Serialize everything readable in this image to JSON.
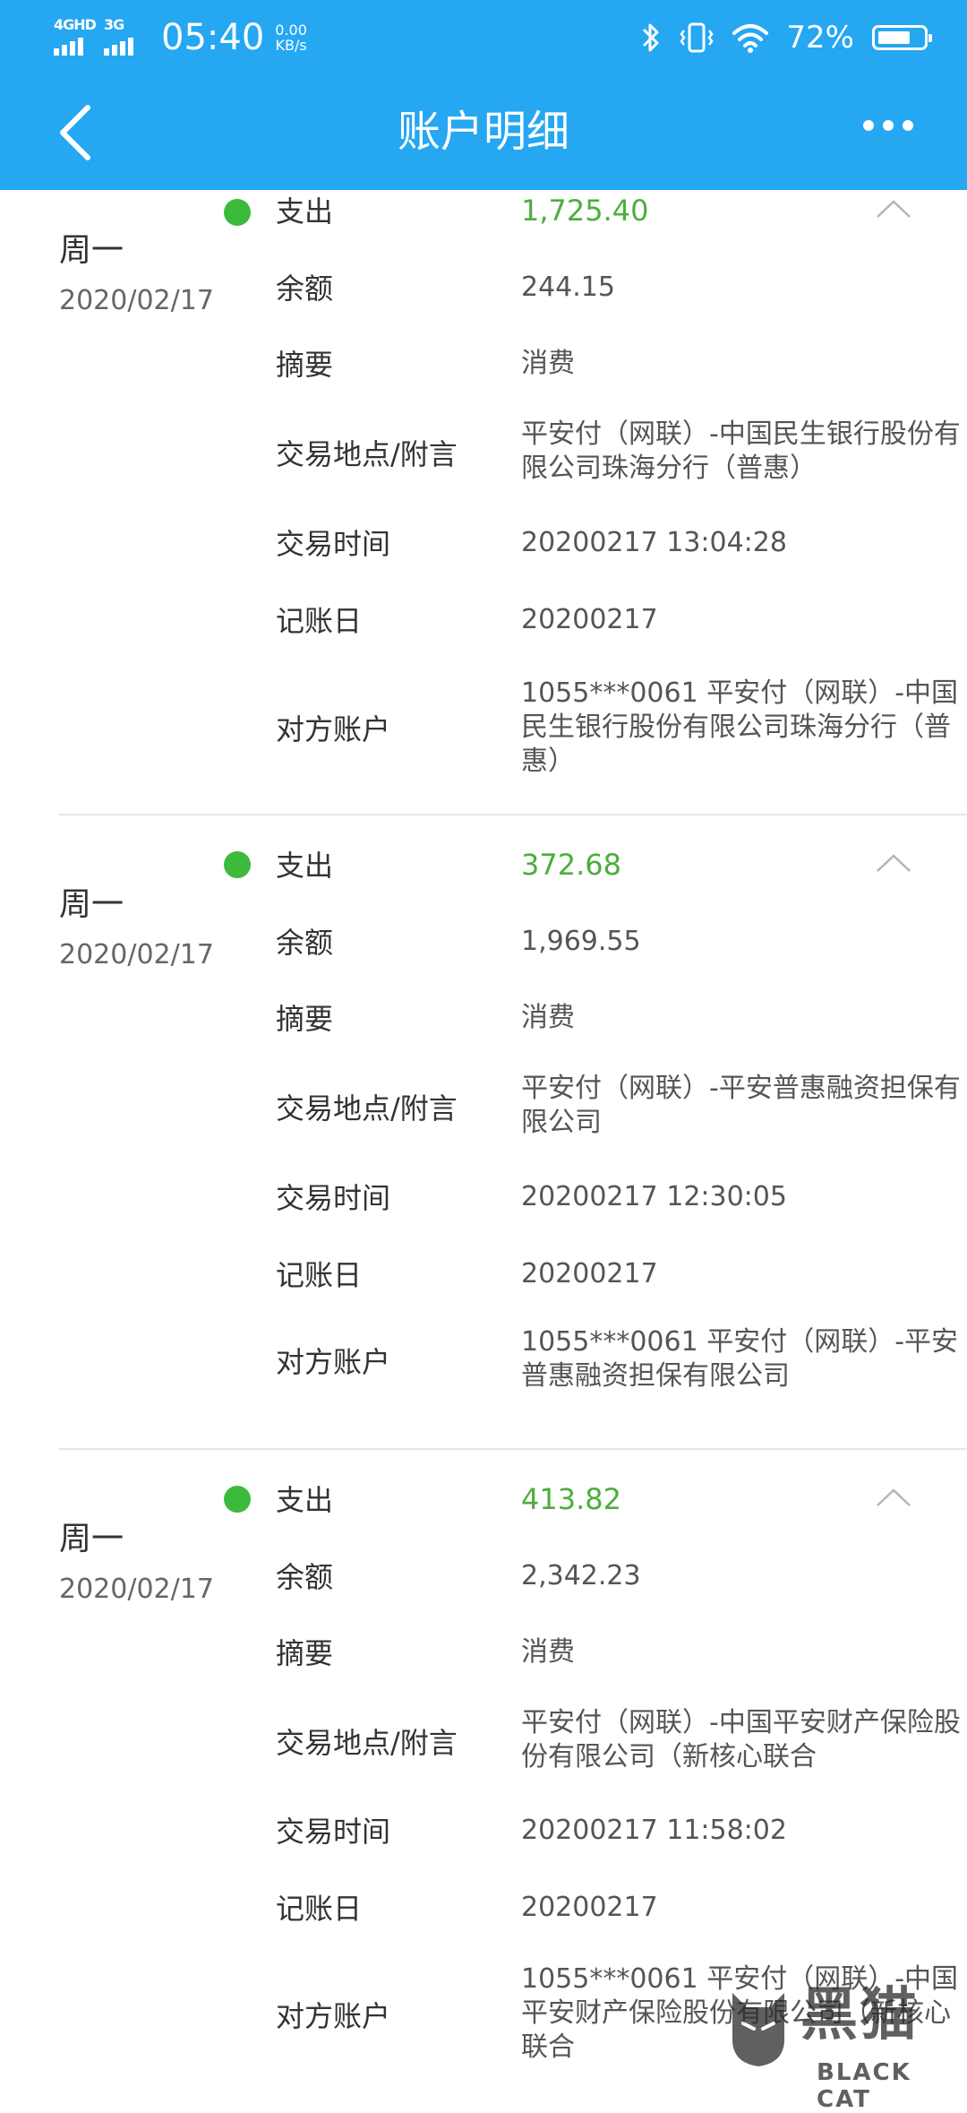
{
  "status_bar": {
    "network1": "4GHD",
    "network2": "3G",
    "time": "05:40",
    "speed_value": "0.00",
    "speed_unit": "KB/s",
    "battery_percent": "72%",
    "battery_level": 0.72,
    "icons": [
      "bluetooth-icon",
      "vibrate-icon",
      "wifi-icon",
      "battery-icon"
    ]
  },
  "header": {
    "title": "账户明细",
    "back_icon": "chevron-left-icon",
    "more_icon": "more-dots-icon"
  },
  "colors": {
    "accent": "#25a7f2",
    "amount_green": "#4cae3c",
    "dot_green": "#3cba3c"
  },
  "labels": {
    "type": "支出",
    "balance": "余额",
    "summary": "摘要",
    "location": "交易地点/附言",
    "time": "交易时间",
    "posting_date": "记账日",
    "counterparty": "对方账户"
  },
  "transactions": [
    {
      "weekday": "周一",
      "date": "2020/02/17",
      "amount": "1,725.40",
      "balance": "244.15",
      "summary": "消费",
      "location": "平安付（网联）-中国民生银行股份有限公司珠海分行（普惠）",
      "time": "20200217 13:04:28",
      "posting_date": "20200217",
      "counterparty": "1055***0061 平安付（网联）-中国民生银行股份有限公司珠海分行（普惠）"
    },
    {
      "weekday": "周一",
      "date": "2020/02/17",
      "amount": "372.68",
      "balance": "1,969.55",
      "summary": "消费",
      "location": "平安付（网联）-平安普惠融资担保有限公司",
      "time": "20200217 12:30:05",
      "posting_date": "20200217",
      "counterparty": "1055***0061 平安付（网联）-平安普惠融资担保有限公司"
    },
    {
      "weekday": "周一",
      "date": "2020/02/17",
      "amount": "413.82",
      "balance": "2,342.23",
      "summary": "消费",
      "location": "平安付（网联）-中国平安财产保险股份有限公司（新核心联合",
      "time": "20200217 11:58:02",
      "posting_date": "20200217",
      "counterparty": "1055***0061 平安付（网联）-中国平安财产保险股份有限公司（新核心联合"
    }
  ],
  "watermark": {
    "cn": "黑猫",
    "en": "BLACK CAT"
  }
}
